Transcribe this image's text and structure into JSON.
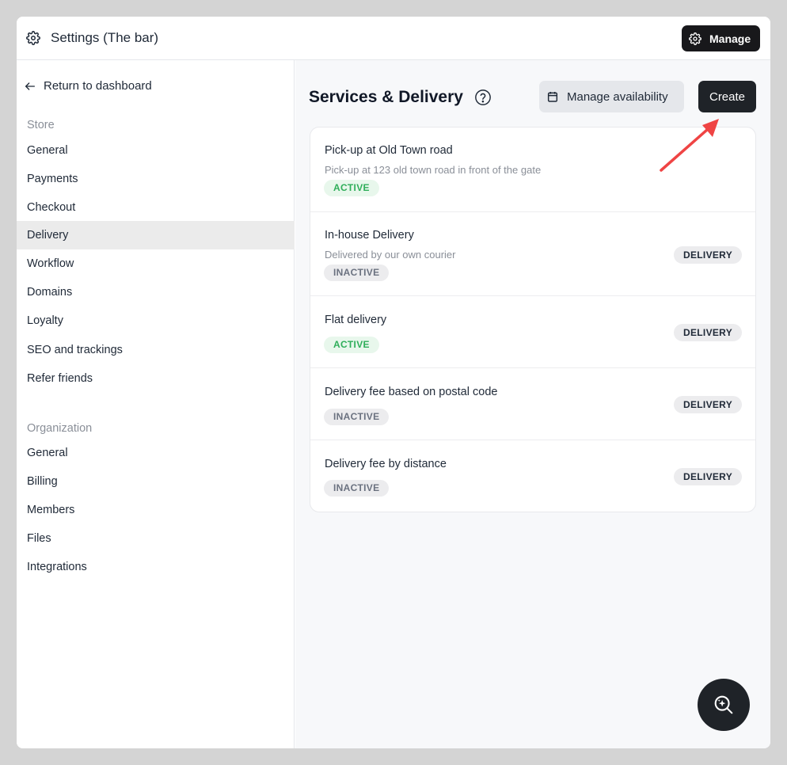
{
  "header": {
    "title": "Settings (The bar)",
    "manage_label": "Manage"
  },
  "sidebar": {
    "back_label": "Return to dashboard",
    "store_label": "Store",
    "store_items": [
      "General",
      "Payments",
      "Checkout",
      "Delivery",
      "Workflow",
      "Domains",
      "Loyalty",
      "SEO and trackings",
      "Refer friends"
    ],
    "active_item": "Delivery",
    "org_label": "Organization",
    "org_items": [
      "General",
      "Billing",
      "Members",
      "Files",
      "Integrations"
    ]
  },
  "main": {
    "title": "Services & Delivery",
    "availability_label": "Manage availability",
    "create_label": "Create",
    "services": [
      {
        "title": "Pick-up at Old Town road",
        "description": "Pick-up at 123 old town road in front of the gate",
        "status": "ACTIVE",
        "type": ""
      },
      {
        "title": "In-house Delivery",
        "description": "Delivered by our own courier",
        "status": "INACTIVE",
        "type": "DELIVERY"
      },
      {
        "title": "Flat delivery",
        "description": "",
        "status": "ACTIVE",
        "type": "DELIVERY"
      },
      {
        "title": "Delivery fee based on postal code",
        "description": "",
        "status": "INACTIVE",
        "type": "DELIVERY"
      },
      {
        "title": "Delivery fee by distance",
        "description": "",
        "status": "INACTIVE",
        "type": "DELIVERY"
      }
    ]
  },
  "colors": {
    "accent_dark": "#1f2328",
    "active_green": "#2fae5a",
    "annotation_arrow": "#ef4444"
  },
  "icons": {
    "header": "gear-icon",
    "back": "arrow-left-icon",
    "help": "question-circle-icon",
    "availability": "calendar-icon",
    "fab": "magnifier-sparkle-icon"
  }
}
